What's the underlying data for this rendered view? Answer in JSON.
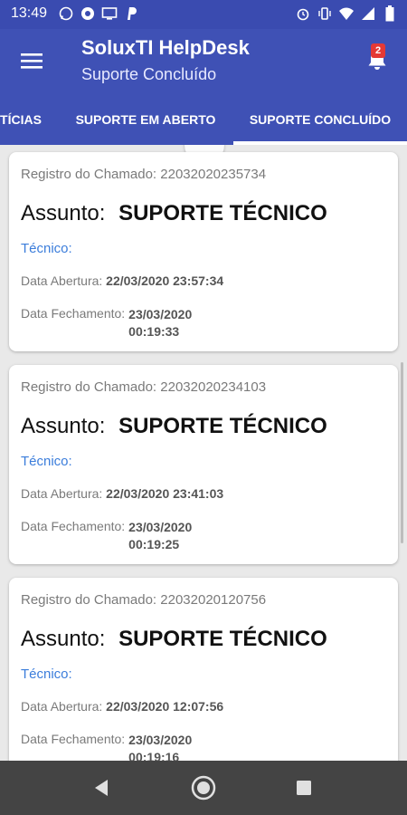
{
  "status_bar": {
    "time": "13:49",
    "left_icons": [
      "whatsapp-icon",
      "chrome-icon",
      "cast-icon",
      "paypal-icon"
    ],
    "right_icons": [
      "alarm-icon",
      "vibrate-icon",
      "wifi-icon",
      "signal-icon",
      "battery-icon"
    ]
  },
  "app_bar": {
    "title": "SoluxTI HelpDesk",
    "subtitle": "Suporte Concluído",
    "notification_count": "2"
  },
  "tabs": [
    {
      "label": "TÍCIAS"
    },
    {
      "label": "SUPORTE EM ABERTO"
    },
    {
      "label": "SUPORTE CONCLUÍDO",
      "selected": true
    }
  ],
  "tickets": [
    {
      "registro_label": "Registro do Chamado:",
      "registro_value": "22032020235734",
      "assunto_label": "Assunto:",
      "assunto_value": "SUPORTE TÉCNICO",
      "tecnico_label": "Técnico:",
      "abertura_label": "Data Abertura:",
      "abertura_value": "22/03/2020 23:57:34",
      "fechamento_label": "Data Fechamento:",
      "fechamento_date": "23/03/2020",
      "fechamento_time": "00:19:33"
    },
    {
      "registro_label": "Registro do Chamado:",
      "registro_value": "22032020234103",
      "assunto_label": "Assunto:",
      "assunto_value": "SUPORTE TÉCNICO",
      "tecnico_label": "Técnico:",
      "abertura_label": "Data Abertura:",
      "abertura_value": "22/03/2020 23:41:03",
      "fechamento_label": "Data Fechamento:",
      "fechamento_date": "23/03/2020",
      "fechamento_time": "00:19:25"
    },
    {
      "registro_label": "Registro do Chamado:",
      "registro_value": "22032020120756",
      "assunto_label": "Assunto:",
      "assunto_value": "SUPORTE TÉCNICO",
      "tecnico_label": "Técnico:",
      "abertura_label": "Data Abertura:",
      "abertura_value": "22/03/2020 12:07:56",
      "fechamento_label": "Data Fechamento:",
      "fechamento_date": "23/03/2020",
      "fechamento_time": "00:19:16"
    }
  ],
  "nav_bar": {
    "icons": [
      "back-icon",
      "home-icon",
      "recents-icon"
    ]
  },
  "colors": {
    "primary": "#3f51b5",
    "status_bar": "#3a4bb0",
    "accent_link": "#3b7ddb",
    "badge": "#e53935",
    "nav_bar": "#444444"
  }
}
